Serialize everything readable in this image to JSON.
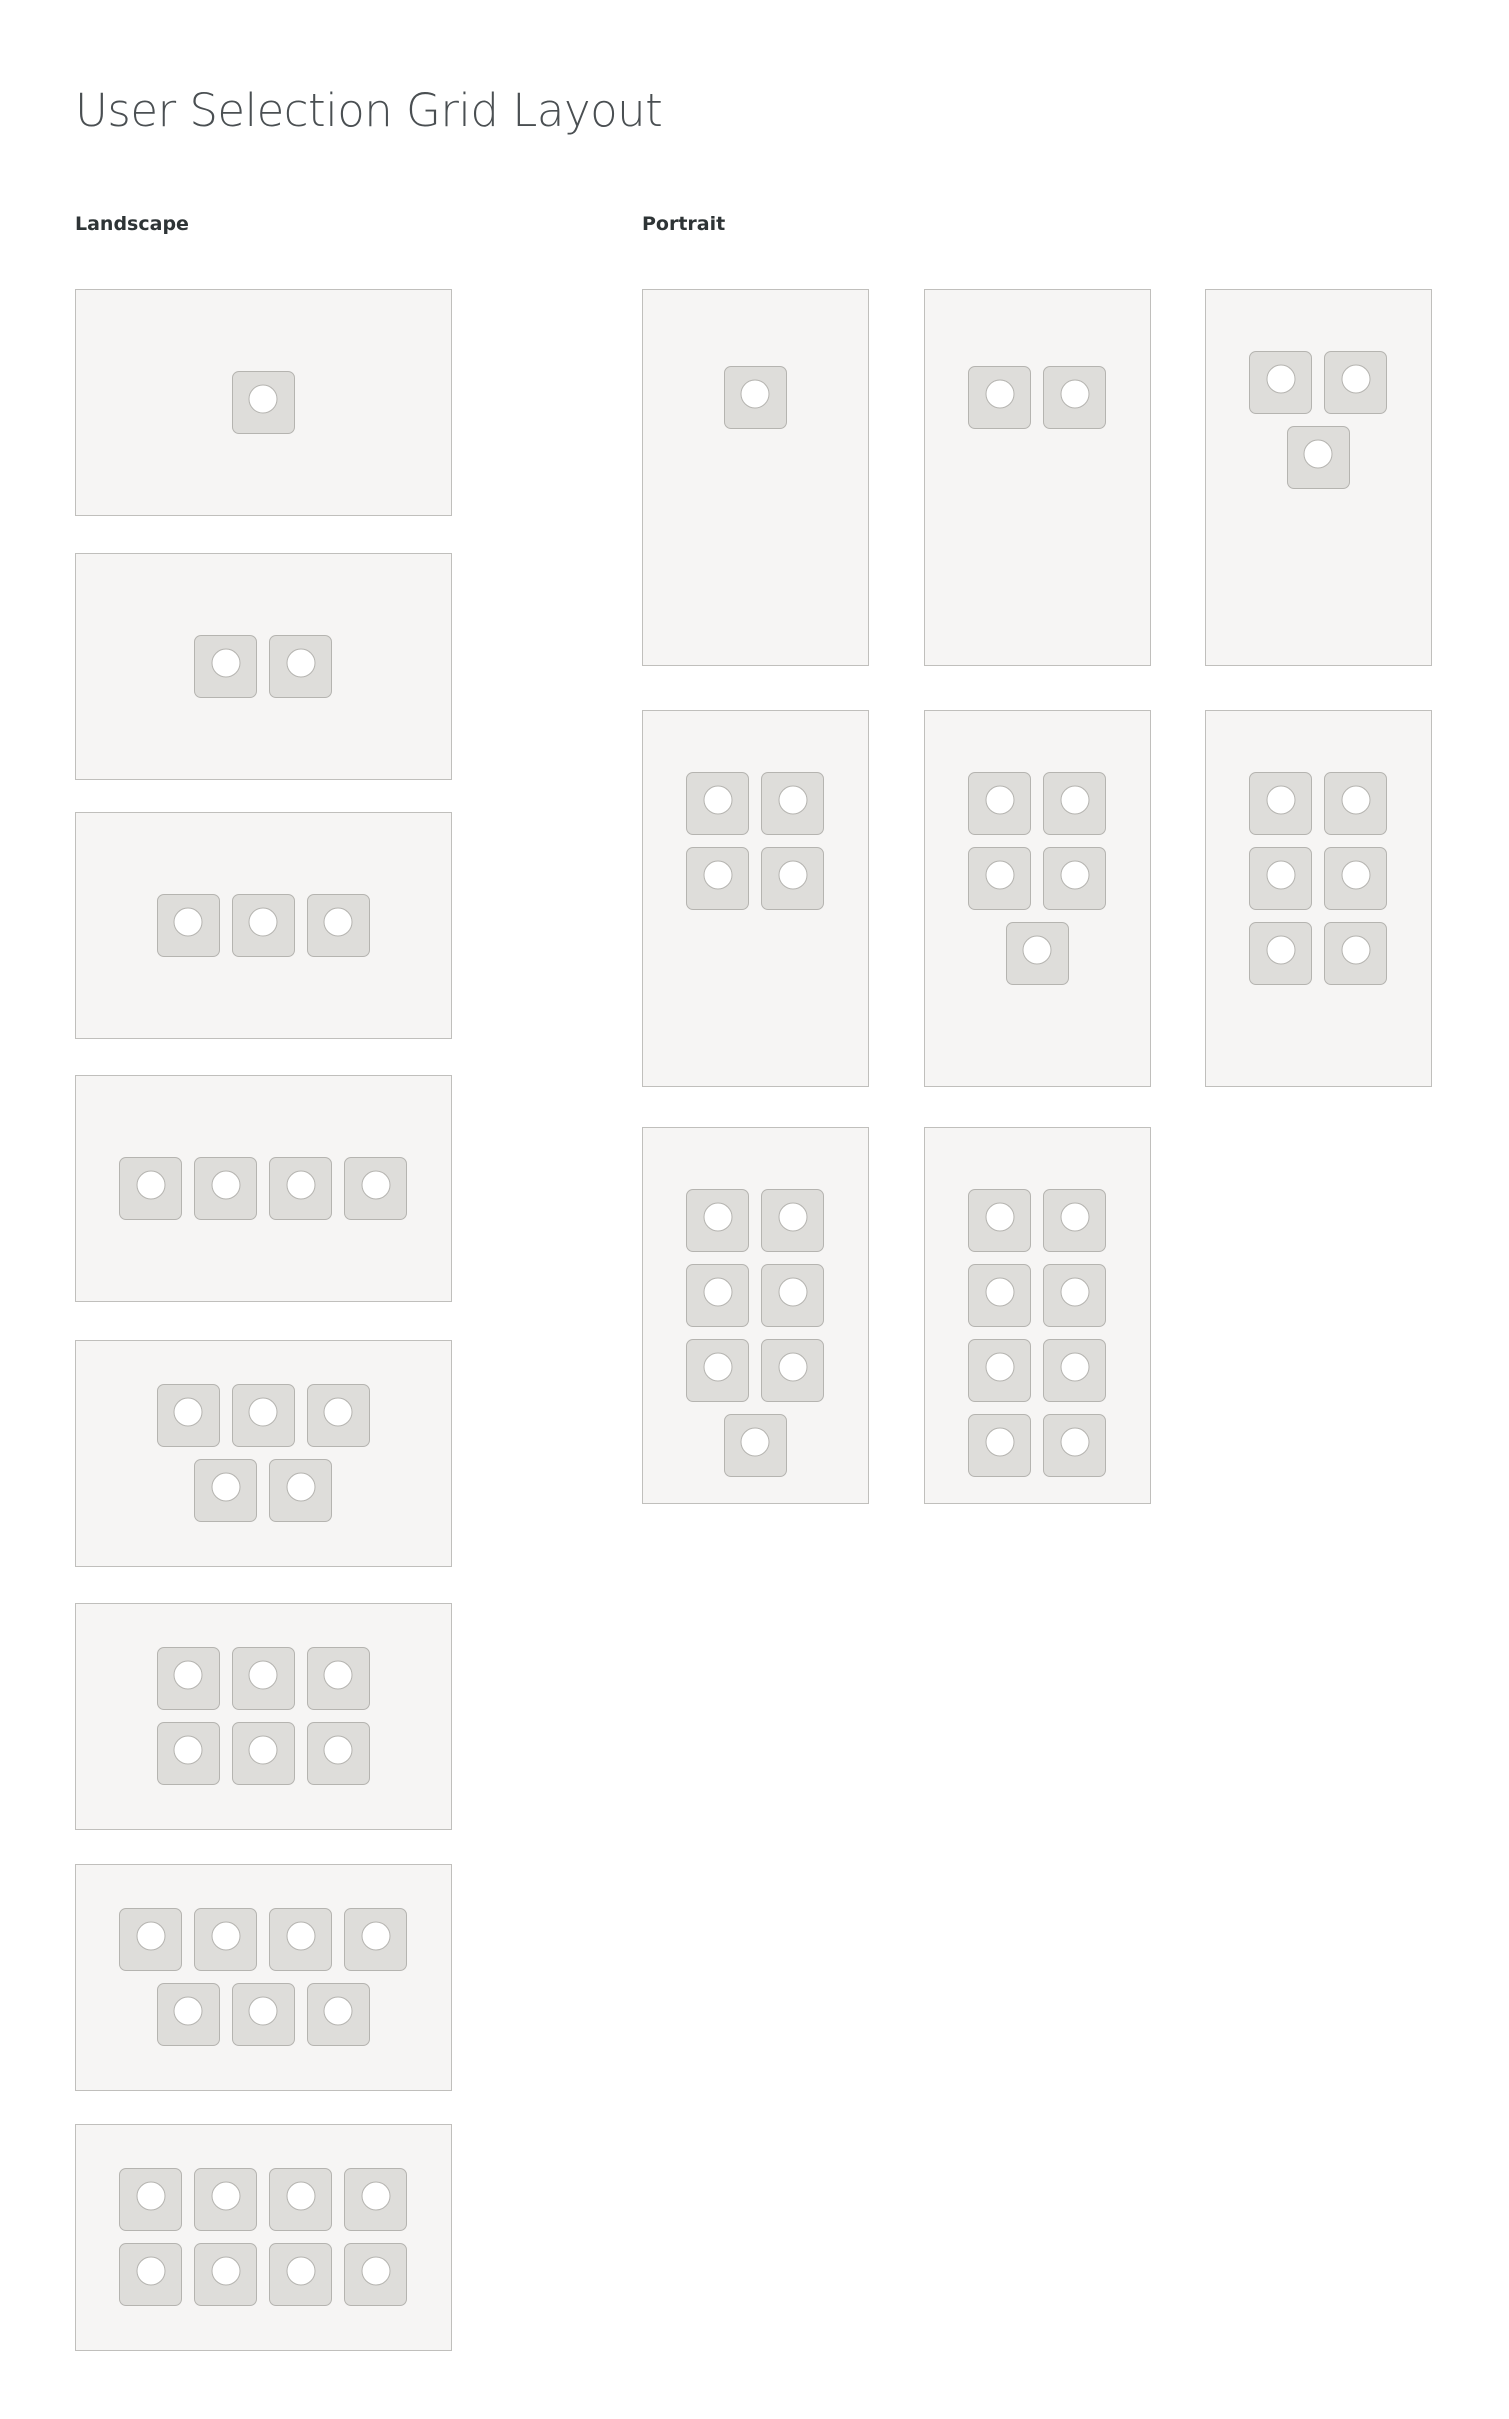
{
  "title": "User Selection Grid Layout",
  "sections": {
    "landscape": {
      "label": "Landscape",
      "layouts": [
        {
          "users": 1,
          "rows": [
            1
          ]
        },
        {
          "users": 2,
          "rows": [
            2
          ]
        },
        {
          "users": 3,
          "rows": [
            3
          ]
        },
        {
          "users": 4,
          "rows": [
            4
          ]
        },
        {
          "users": 5,
          "rows": [
            3,
            2
          ]
        },
        {
          "users": 6,
          "rows": [
            3,
            3
          ]
        },
        {
          "users": 7,
          "rows": [
            4,
            3
          ]
        },
        {
          "users": 8,
          "rows": [
            4,
            4
          ]
        }
      ]
    },
    "portrait": {
      "label": "Portrait",
      "layouts": [
        {
          "users": 1,
          "rows": [
            1
          ]
        },
        {
          "users": 2,
          "rows": [
            2
          ]
        },
        {
          "users": 3,
          "rows": [
            2,
            1
          ]
        },
        {
          "users": 4,
          "rows": [
            2,
            2
          ]
        },
        {
          "users": 5,
          "rows": [
            2,
            2,
            1
          ]
        },
        {
          "users": 6,
          "rows": [
            2,
            2,
            2
          ]
        },
        {
          "users": 7,
          "rows": [
            2,
            2,
            2,
            1
          ]
        },
        {
          "users": 8,
          "rows": [
            2,
            2,
            2,
            2
          ]
        }
      ]
    }
  },
  "colors": {
    "frame_fill": "#f6f5f4",
    "frame_border": "#c0bfbc",
    "tile_fill": "#deddda",
    "tile_border": "#b5b4b0",
    "avatar_fill": "#ffffff",
    "title_text": "#4a4f52",
    "label_text": "#2e3436"
  }
}
